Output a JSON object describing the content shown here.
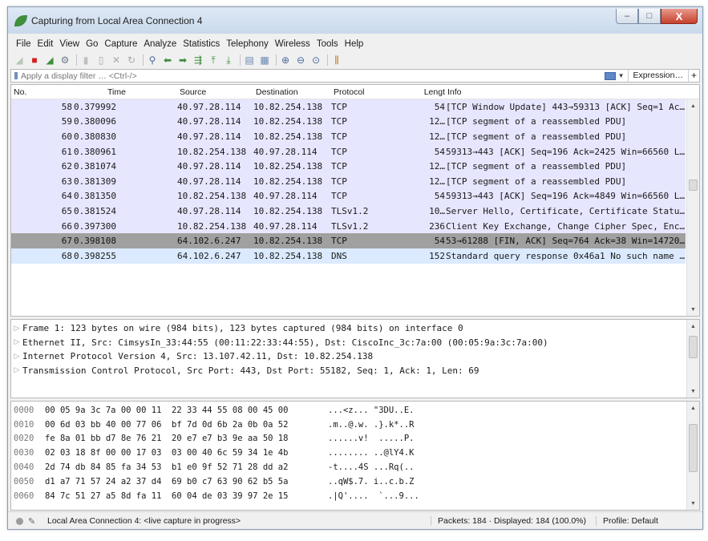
{
  "window": {
    "title": "Capturing from Local Area Connection 4",
    "controls": {
      "minimize": "–",
      "maximize": "□",
      "close": "X"
    }
  },
  "menu": [
    "File",
    "Edit",
    "View",
    "Go",
    "Capture",
    "Analyze",
    "Statistics",
    "Telephony",
    "Wireless",
    "Tools",
    "Help"
  ],
  "toolbar": {
    "icons": [
      {
        "name": "start-capture-icon",
        "glyph": "◢",
        "color": "#b8c8b8"
      },
      {
        "name": "stop-capture-icon",
        "glyph": "■",
        "color": "#d42020"
      },
      {
        "name": "restart-capture-icon",
        "glyph": "◢",
        "color": "#3f8f3c"
      },
      {
        "name": "capture-options-icon",
        "glyph": "⚙",
        "color": "#6c7a8a"
      },
      {
        "name": "open-file-icon",
        "glyph": "▮",
        "color": "#c0c0c0"
      },
      {
        "name": "save-file-icon",
        "glyph": "▯",
        "color": "#a8a8a8"
      },
      {
        "name": "close-file-icon",
        "glyph": "✕",
        "color": "#a8a8a8"
      },
      {
        "name": "reload-file-icon",
        "glyph": "↻",
        "color": "#a8a8a8"
      },
      {
        "name": "find-packet-icon",
        "glyph": "⚲",
        "color": "#4a6a9a"
      },
      {
        "name": "go-back-icon",
        "glyph": "⬅",
        "color": "#3c8c3c"
      },
      {
        "name": "go-forward-icon",
        "glyph": "➡",
        "color": "#3c8c3c"
      },
      {
        "name": "go-to-packet-icon",
        "glyph": "⇶",
        "color": "#3c8c3c"
      },
      {
        "name": "go-first-packet-icon",
        "glyph": "⤒",
        "color": "#3c8c3c"
      },
      {
        "name": "go-last-packet-icon",
        "glyph": "⤓",
        "color": "#3c8c3c"
      },
      {
        "name": "auto-scroll-icon",
        "glyph": "▤",
        "color": "#6a86b0"
      },
      {
        "name": "colorize-icon",
        "glyph": "▦",
        "color": "#6a86b0"
      },
      {
        "name": "zoom-in-icon",
        "glyph": "⊕",
        "color": "#4a6a9a"
      },
      {
        "name": "zoom-out-icon",
        "glyph": "⊖",
        "color": "#4a6a9a"
      },
      {
        "name": "zoom-normal-icon",
        "glyph": "⊙",
        "color": "#4a6a9a"
      },
      {
        "name": "resize-columns-icon",
        "glyph": "⫼",
        "color": "#b87a20"
      }
    ]
  },
  "filter": {
    "placeholder": "Apply a display filter … <Ctrl-/>",
    "expression_label": "Expression…",
    "plus_label": "+"
  },
  "packet_list": {
    "columns": [
      "No.",
      "Time",
      "Source",
      "Destination",
      "Protocol",
      "Lengt",
      "Info"
    ],
    "rows": [
      {
        "no": "58",
        "time": "0.379992",
        "src": "40.97.28.114",
        "dst": "10.82.254.138",
        "proto": "TCP",
        "len": "54",
        "info": "[TCP Window Update] 443→59313 [ACK] Seq=1 Ac…",
        "state": "normal"
      },
      {
        "no": "59",
        "time": "0.380096",
        "src": "40.97.28.114",
        "dst": "10.82.254.138",
        "proto": "TCP",
        "len": "12…",
        "info": "[TCP segment of a reassembled PDU]",
        "state": "normal"
      },
      {
        "no": "60",
        "time": "0.380830",
        "src": "40.97.28.114",
        "dst": "10.82.254.138",
        "proto": "TCP",
        "len": "12…",
        "info": "[TCP segment of a reassembled PDU]",
        "state": "normal"
      },
      {
        "no": "61",
        "time": "0.380961",
        "src": "10.82.254.138",
        "dst": "40.97.28.114",
        "proto": "TCP",
        "len": "54",
        "info": "59313→443 [ACK] Seq=196 Ack=2425 Win=66560 L…",
        "state": "normal"
      },
      {
        "no": "62",
        "time": "0.381074",
        "src": "40.97.28.114",
        "dst": "10.82.254.138",
        "proto": "TCP",
        "len": "12…",
        "info": "[TCP segment of a reassembled PDU]",
        "state": "normal"
      },
      {
        "no": "63",
        "time": "0.381309",
        "src": "40.97.28.114",
        "dst": "10.82.254.138",
        "proto": "TCP",
        "len": "12…",
        "info": "[TCP segment of a reassembled PDU]",
        "state": "normal"
      },
      {
        "no": "64",
        "time": "0.381350",
        "src": "10.82.254.138",
        "dst": "40.97.28.114",
        "proto": "TCP",
        "len": "54",
        "info": "59313→443 [ACK] Seq=196 Ack=4849 Win=66560 L…",
        "state": "normal"
      },
      {
        "no": "65",
        "time": "0.381524",
        "src": "40.97.28.114",
        "dst": "10.82.254.138",
        "proto": "TLSv1.2",
        "len": "10…",
        "info": "Server Hello, Certificate, Certificate Statu…",
        "state": "normal"
      },
      {
        "no": "66",
        "time": "0.397300",
        "src": "10.82.254.138",
        "dst": "40.97.28.114",
        "proto": "TLSv1.2",
        "len": "236",
        "info": "Client Key Exchange, Change Cipher Spec, Enc…",
        "state": "normal"
      },
      {
        "no": "67",
        "time": "0.398108",
        "src": "64.102.6.247",
        "dst": "10.82.254.138",
        "proto": "TCP",
        "len": "54",
        "info": "53→61288 [FIN, ACK] Seq=764 Ack=38 Win=14720…",
        "state": "selected"
      },
      {
        "no": "68",
        "time": "0.398255",
        "src": "64.102.6.247",
        "dst": "10.82.254.138",
        "proto": "DNS",
        "len": "152",
        "info": "Standard query response 0x46a1 No such name …",
        "state": "dns"
      }
    ]
  },
  "details": [
    "Frame 1: 123 bytes on wire (984 bits), 123 bytes captured (984 bits) on interface 0",
    "Ethernet II, Src: CimsysIn_33:44:55 (00:11:22:33:44:55), Dst: CiscoInc_3c:7a:00 (00:05:9a:3c:7a:00)",
    "Internet Protocol Version 4, Src: 13.107.42.11, Dst: 10.82.254.138",
    "Transmission Control Protocol, Src Port: 443, Dst Port: 55182, Seq: 1, Ack: 1, Len: 69"
  ],
  "bytes": [
    {
      "offset": "0000",
      "hex": "00 05 9a 3c 7a 00 00 11  22 33 44 55 08 00 45 00",
      "ascii": "...<z... \"3DU..E."
    },
    {
      "offset": "0010",
      "hex": "00 6d 03 bb 40 00 77 06  bf 7d 0d 6b 2a 0b 0a 52",
      "ascii": ".m..@.w. .}.k*..R"
    },
    {
      "offset": "0020",
      "hex": "fe 8a 01 bb d7 8e 76 21  20 e7 e7 b3 9e aa 50 18",
      "ascii": "......v!  .....P."
    },
    {
      "offset": "0030",
      "hex": "02 03 18 8f 00 00 17 03  03 00 40 6c 59 34 1e 4b",
      "ascii": "........ ..@lY4.K"
    },
    {
      "offset": "0040",
      "hex": "2d 74 db 84 85 fa 34 53  b1 e0 9f 52 71 28 dd a2",
      "ascii": "-t....4S ...Rq(.."
    },
    {
      "offset": "0050",
      "hex": "d1 a7 71 57 24 a2 37 d4  69 b0 c7 63 90 62 b5 5a",
      "ascii": "..qW$.7. i..c.b.Z"
    },
    {
      "offset": "0060",
      "hex": "84 7c 51 27 a5 8d fa 11  60 04 de 03 39 97 2e 15",
      "ascii": ".|Q'....  `...9..."
    }
  ],
  "status": {
    "capture_text": "Local Area Connection 4: <live capture in progress>",
    "packets": "Packets: 184 · Displayed: 184 (100.0%)",
    "profile": "Profile: Default"
  }
}
